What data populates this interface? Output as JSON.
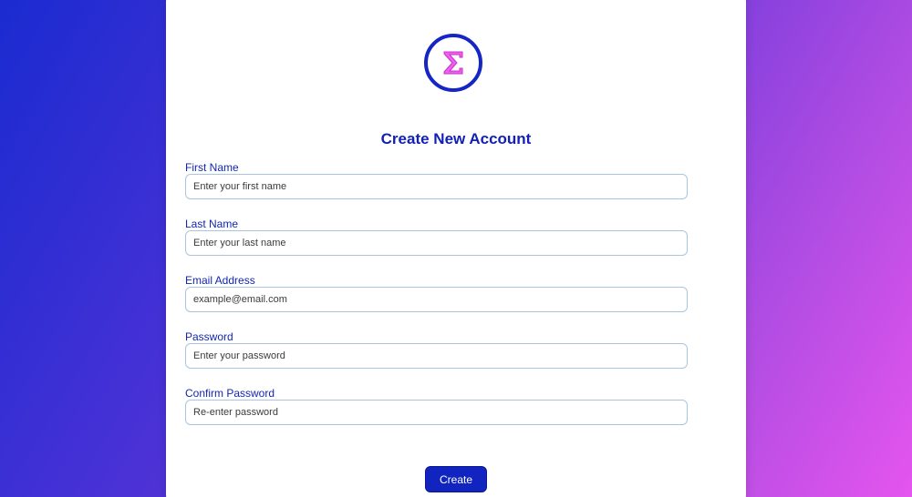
{
  "logo": {
    "icon": "sigma-icon",
    "symbol": "Σ",
    "ring_color": "#1526c4",
    "glyph_color": "#f25cf0"
  },
  "form": {
    "title": "Create New Account",
    "fields": [
      {
        "label": "First Name",
        "placeholder": "Enter your first name",
        "value": ""
      },
      {
        "label": "Last Name",
        "placeholder": "Enter your last name",
        "value": ""
      },
      {
        "label": "Email Address",
        "placeholder": "example@email.com",
        "value": ""
      },
      {
        "label": "Password",
        "placeholder": "Enter your password",
        "value": ""
      },
      {
        "label": "Confirm Password",
        "placeholder": "Re-enter password",
        "value": ""
      }
    ],
    "submit_label": "Create"
  },
  "colors": {
    "accent": "#1224c0",
    "label": "#1226b0",
    "background_gradient": [
      "#1a2bd0",
      "#e455ee"
    ]
  }
}
